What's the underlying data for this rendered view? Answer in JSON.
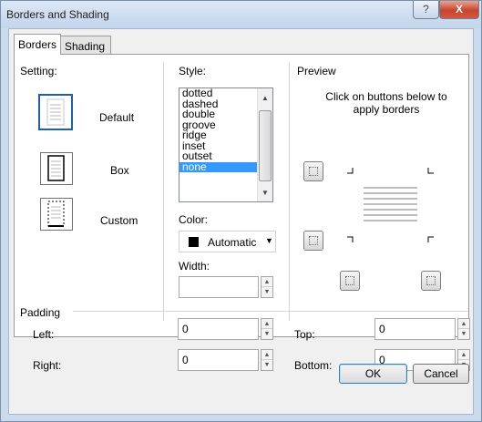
{
  "window": {
    "title": "Borders and Shading",
    "help_label": "?",
    "close_label": "X"
  },
  "tabs": [
    {
      "label": "Borders"
    },
    {
      "label": "Shading"
    }
  ],
  "setting": {
    "heading": "Setting:",
    "options": [
      {
        "label": "Default"
      },
      {
        "label": "Box"
      },
      {
        "label": "Custom"
      }
    ],
    "selected": "Default"
  },
  "style": {
    "heading": "Style:",
    "items": [
      "dotted",
      "dashed",
      "double",
      "groove",
      "ridge",
      "inset",
      "outset",
      "none"
    ],
    "selected": "none"
  },
  "color": {
    "heading": "Color:",
    "value": "Automatic",
    "swatch": "#000000"
  },
  "width": {
    "heading": "Width:",
    "value": ""
  },
  "preview": {
    "heading": "Preview",
    "instructions": "Click on buttons below to apply borders"
  },
  "padding": {
    "heading": "Padding",
    "left": {
      "label": "Left:",
      "value": "0"
    },
    "right": {
      "label": "Right:",
      "value": "0"
    },
    "top": {
      "label": "Top:",
      "value": "0"
    },
    "bottom": {
      "label": "Bottom:",
      "value": "0"
    }
  },
  "buttons": {
    "ok": "OK",
    "cancel": "Cancel"
  }
}
